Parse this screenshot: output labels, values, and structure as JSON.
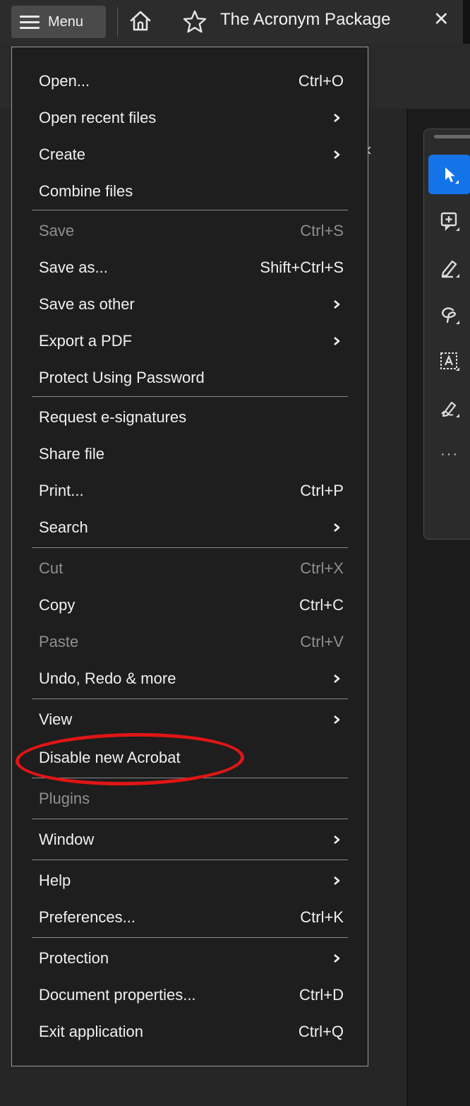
{
  "topbar": {
    "menu_label": "Menu",
    "tab_title": "The Acronym Package",
    "close_symbol": "✕",
    "icons": [
      "hamburger-icon",
      "home-icon",
      "star-icon",
      "close-icon"
    ]
  },
  "side_panel": {
    "collapse_symbol": "‹"
  },
  "toolbar": {
    "tools": [
      {
        "icon": "select-arrow-icon",
        "selected": true
      },
      {
        "icon": "add-comment-icon",
        "selected": false
      },
      {
        "icon": "highlight-pen-icon",
        "selected": false
      },
      {
        "icon": "lasso-draw-icon",
        "selected": false
      },
      {
        "icon": "text-recognition-icon",
        "selected": false
      },
      {
        "icon": "sign-icon",
        "selected": false
      }
    ],
    "more_label": "···"
  },
  "menu": {
    "items": [
      {
        "label": "Open...",
        "shortcut": "Ctrl+O",
        "submenu": false,
        "disabled": false
      },
      {
        "label": "Open recent files",
        "shortcut": "",
        "submenu": true,
        "disabled": false
      },
      {
        "label": "Create",
        "shortcut": "",
        "submenu": true,
        "disabled": false
      },
      {
        "label": "Combine files",
        "shortcut": "",
        "submenu": false,
        "disabled": false
      },
      {
        "label": "Save",
        "shortcut": "Ctrl+S",
        "submenu": false,
        "disabled": true
      },
      {
        "label": "Save as...",
        "shortcut": "Shift+Ctrl+S",
        "submenu": false,
        "disabled": false
      },
      {
        "label": "Save as other",
        "shortcut": "",
        "submenu": true,
        "disabled": false
      },
      {
        "label": "Export a PDF",
        "shortcut": "",
        "submenu": true,
        "disabled": false
      },
      {
        "label": "Protect Using Password",
        "shortcut": "",
        "submenu": false,
        "disabled": false
      },
      {
        "label": "Request e-signatures",
        "shortcut": "",
        "submenu": false,
        "disabled": false
      },
      {
        "label": "Share file",
        "shortcut": "",
        "submenu": false,
        "disabled": false
      },
      {
        "label": "Print...",
        "shortcut": "Ctrl+P",
        "submenu": false,
        "disabled": false
      },
      {
        "label": "Search",
        "shortcut": "",
        "submenu": true,
        "disabled": false
      },
      {
        "label": "Cut",
        "shortcut": "Ctrl+X",
        "submenu": false,
        "disabled": true
      },
      {
        "label": "Copy",
        "shortcut": "Ctrl+C",
        "submenu": false,
        "disabled": false
      },
      {
        "label": "Paste",
        "shortcut": "Ctrl+V",
        "submenu": false,
        "disabled": true
      },
      {
        "label": "Undo, Redo & more",
        "shortcut": "",
        "submenu": true,
        "disabled": false
      },
      {
        "label": "View",
        "shortcut": "",
        "submenu": true,
        "disabled": false
      },
      {
        "label": "Disable new Acrobat",
        "shortcut": "",
        "submenu": false,
        "disabled": false,
        "highlighted": true
      },
      {
        "label": "Plugins",
        "shortcut": "",
        "submenu": false,
        "disabled": true
      },
      {
        "label": "Window",
        "shortcut": "",
        "submenu": true,
        "disabled": false
      },
      {
        "label": "Help",
        "shortcut": "",
        "submenu": true,
        "disabled": false
      },
      {
        "label": "Preferences...",
        "shortcut": "Ctrl+K",
        "submenu": false,
        "disabled": false
      },
      {
        "label": "Protection",
        "shortcut": "",
        "submenu": true,
        "disabled": false
      },
      {
        "label": "Document properties...",
        "shortcut": "Ctrl+D",
        "submenu": false,
        "disabled": false
      },
      {
        "label": "Exit application",
        "shortcut": "Ctrl+Q",
        "submenu": false,
        "disabled": false
      }
    ],
    "annotation_color": "#e01515"
  },
  "colors": {
    "accent": "#1473e6",
    "menu_bg": "#1e1e1e",
    "disabled_text": "#8f8f8f",
    "annotation": "#e01515"
  }
}
